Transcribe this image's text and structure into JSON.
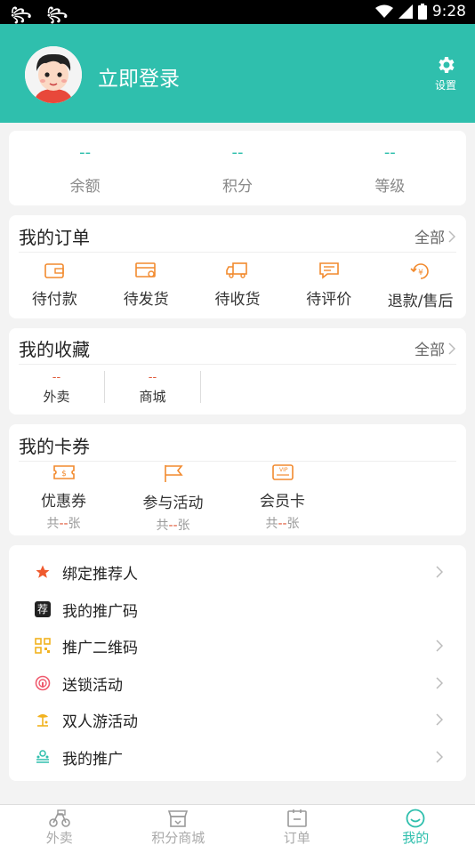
{
  "status_bar": {
    "time": "9:28",
    "left_icons": "꧂ ꧂"
  },
  "header": {
    "login_text": "立即登录",
    "settings_label": "设置"
  },
  "stats": [
    {
      "value": "--",
      "label": "余额"
    },
    {
      "value": "--",
      "label": "积分"
    },
    {
      "value": "--",
      "label": "等级"
    }
  ],
  "orders": {
    "title": "我的订单",
    "all_label": "全部",
    "items": [
      {
        "label": "待付款",
        "icon": "wallet-icon"
      },
      {
        "label": "待发货",
        "icon": "box-icon"
      },
      {
        "label": "待收货",
        "icon": "truck-icon"
      },
      {
        "label": "待评价",
        "icon": "comment-icon"
      },
      {
        "label": "退款/售后",
        "icon": "refund-icon"
      }
    ]
  },
  "favorites": {
    "title": "我的收藏",
    "all_label": "全部",
    "items": [
      {
        "value": "--",
        "label": "外卖"
      },
      {
        "value": "--",
        "label": "商城"
      }
    ]
  },
  "coupons": {
    "title": "我的卡券",
    "items": [
      {
        "label": "优惠券",
        "count_prefix": "共",
        "count": "--",
        "count_suffix": "张",
        "icon": "coupon-icon"
      },
      {
        "label": "参与活动",
        "count_prefix": "共",
        "count": "--",
        "count_suffix": "张",
        "icon": "flag-icon"
      },
      {
        "label": "会员卡",
        "count_prefix": "共",
        "count": "--",
        "count_suffix": "张",
        "icon": "vip-card-icon"
      }
    ]
  },
  "menu": [
    {
      "label": "绑定推荐人",
      "icon": "star-icon",
      "chevron": true
    },
    {
      "label": "我的推广码",
      "icon": "recommend-badge-icon",
      "badge": "荐",
      "chevron": false
    },
    {
      "label": "推广二维码",
      "icon": "qrcode-icon",
      "chevron": true
    },
    {
      "label": "送锁活动",
      "icon": "lock-gift-icon",
      "chevron": true
    },
    {
      "label": "双人游活动",
      "icon": "travel-icon",
      "chevron": true
    },
    {
      "label": "我的推广",
      "icon": "promotion-icon",
      "chevron": true
    }
  ],
  "tabbar": [
    {
      "label": "外卖",
      "icon": "scooter-icon",
      "active": false
    },
    {
      "label": "积分商城",
      "icon": "store-icon",
      "active": false
    },
    {
      "label": "订单",
      "icon": "order-icon",
      "active": false
    },
    {
      "label": "我的",
      "icon": "smile-icon",
      "active": true
    }
  ],
  "colors": {
    "accent": "#2fbfad",
    "orange": "#f28a2e",
    "red": "#e05a3a"
  }
}
